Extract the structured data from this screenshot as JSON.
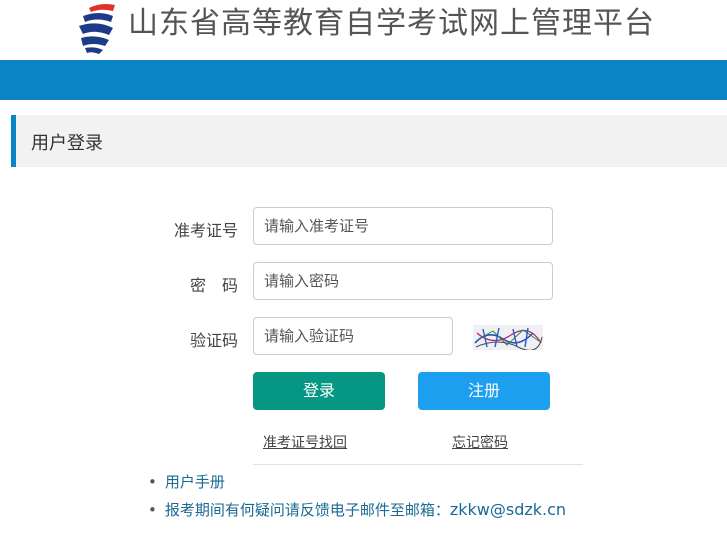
{
  "header": {
    "title": "山东省高等教育自学考试网上管理平台",
    "logo_icon": "sdzk-logo-icon"
  },
  "panel": {
    "title": "用户登录"
  },
  "form": {
    "exam_no_label": "准考证号",
    "exam_no_placeholder": "请输入准考证号",
    "password_label": "密　码",
    "password_placeholder": "请输入密码",
    "captcha_label": "验证码",
    "captcha_placeholder": "请输入验证码",
    "login_label": "登录",
    "register_label": "注册",
    "recover_exam_no": "准考证号找回",
    "forgot_password": "忘记密码"
  },
  "info": {
    "manual": "用户手册",
    "feedback_prefix": "报考期间有何疑问请反馈电子邮件至邮箱：",
    "email": "zkkw@sdzk.cn"
  },
  "colors": {
    "brand_blue": "#0a84c4",
    "login_green": "#069784",
    "register_blue": "#1d9ff0",
    "link_teal": "#1a6a93"
  }
}
